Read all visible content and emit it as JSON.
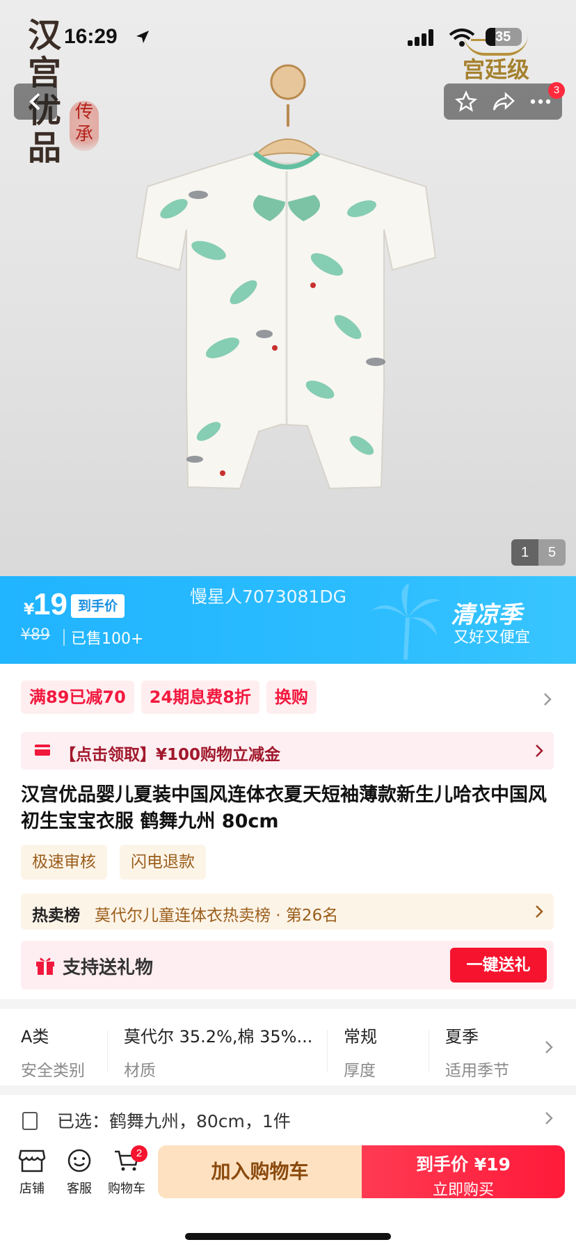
{
  "status_bar": {
    "time": "16:29",
    "battery": "35"
  },
  "brand": {
    "logo_chars": [
      "汉",
      "宫",
      "优",
      "品"
    ],
    "seal_chars": [
      "传",
      "承"
    ],
    "court_title": "宫廷级"
  },
  "gallery": {
    "current": "1",
    "total": "5",
    "notification_count": "3"
  },
  "price": {
    "currency": "¥",
    "current": "19",
    "tag": "到手价",
    "original": "¥89",
    "sold": "已售100+",
    "product_code": "慢星人7073081DG",
    "season_title": "清凉季",
    "season_sub": "又好又便宜"
  },
  "promotions": [
    "满89已减70",
    "24期息费8折",
    "换购"
  ],
  "coupon": {
    "text": "【点击领取】¥100购物立减金"
  },
  "product_title": "汉宫优品婴儿夏装中国风连体衣夏天短袖薄款新生儿哈衣中国风初生宝宝衣服 鹤舞九州 80cm",
  "services": [
    "极速审核",
    "闪电退款"
  ],
  "ranking": {
    "label": "热卖榜",
    "text": "莫代尔儿童连体衣热卖榜 · 第26名"
  },
  "gift": {
    "text": "支持送礼物",
    "button": "一键送礼"
  },
  "attributes": [
    {
      "value": "A类",
      "key": "安全类别"
    },
    {
      "value": "莫代尔 35.2%,棉 35%...",
      "key": "材质"
    },
    {
      "value": "常规",
      "key": "厚度"
    },
    {
      "value": "夏季",
      "key": "适用季节"
    }
  ],
  "selection": {
    "text": "已选：鹤舞九州，80cm，1件"
  },
  "bottom_bar": {
    "store": "店铺",
    "service": "客服",
    "cart": "购物车",
    "cart_count": "2",
    "add_to_cart": "加入购物车",
    "buy_price": "到手价 ¥19",
    "buy_label": "立即购买"
  },
  "colors": {
    "accent_blue": "#21b4ff",
    "accent_red": "#f5132e",
    "cart_orange": "#fde1c1"
  }
}
